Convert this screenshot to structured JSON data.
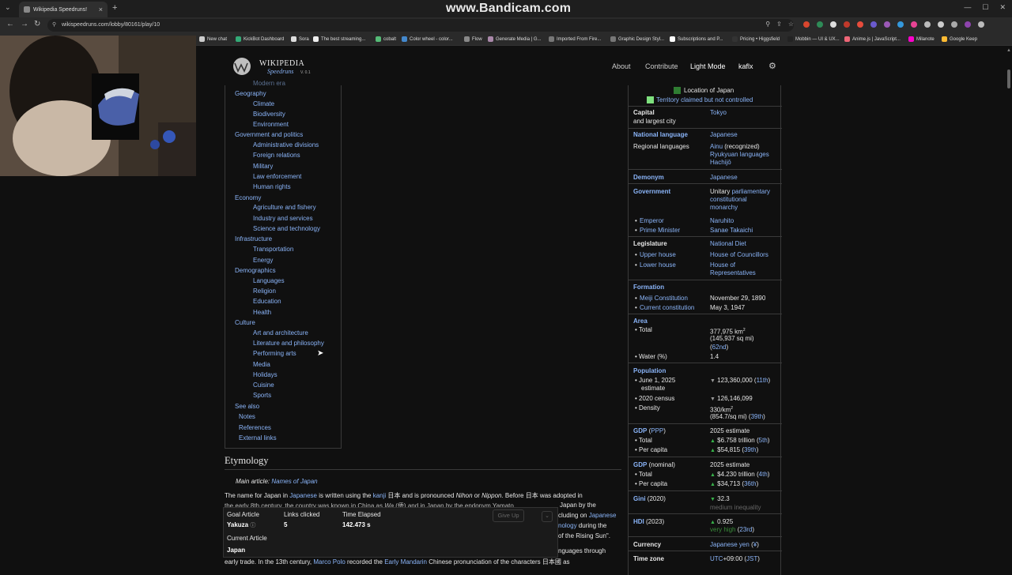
{
  "browser": {
    "tab_title": "Wikipedia Speedruns!",
    "url": "wikispeedruns.com/lobby/80161/play/10",
    "watermark": "www.Bandicam.com",
    "bookmarks": [
      "New chat",
      "KickBot Dashboard",
      "Sora",
      "The best streaming...",
      "cobalt",
      "Color wheel - color...",
      "Flow",
      "Generate Media | G...",
      "Imported From Fire...",
      "Graphic Design Styl...",
      "Subscriptions and P...",
      "Pricing • Higgsfield",
      "Mobbin — UI & UX...",
      "Anime.js | JavaScript...",
      "Milanote",
      "Google Keep"
    ]
  },
  "header": {
    "logo_title": "WIKIPEDIA",
    "logo_sub": "Speedruns",
    "version": "V. 0.1",
    "nav": {
      "about": "About",
      "contribute": "Contribute",
      "light_mode": "Light Mode",
      "user": "kaflx"
    }
  },
  "toc": {
    "items": [
      {
        "label": "Modern era",
        "indent": true
      },
      {
        "label": "Geography",
        "indent": false
      },
      {
        "label": "Climate",
        "indent": true
      },
      {
        "label": "Biodiversity",
        "indent": true
      },
      {
        "label": "Environment",
        "indent": true
      },
      {
        "label": "Government and politics",
        "indent": false
      },
      {
        "label": "Administrative divisions",
        "indent": true
      },
      {
        "label": "Foreign relations",
        "indent": true
      },
      {
        "label": "Military",
        "indent": true
      },
      {
        "label": "Law enforcement",
        "indent": true
      },
      {
        "label": "Human rights",
        "indent": true
      },
      {
        "label": "Economy",
        "indent": false
      },
      {
        "label": "Agriculture and fishery",
        "indent": true
      },
      {
        "label": "Industry and services",
        "indent": true
      },
      {
        "label": "Science and technology",
        "indent": true
      },
      {
        "label": "Infrastructure",
        "indent": false
      },
      {
        "label": "Transportation",
        "indent": true
      },
      {
        "label": "Energy",
        "indent": true
      },
      {
        "label": "Demographics",
        "indent": false
      },
      {
        "label": "Languages",
        "indent": true
      },
      {
        "label": "Religion",
        "indent": true
      },
      {
        "label": "Education",
        "indent": true
      },
      {
        "label": "Health",
        "indent": true
      },
      {
        "label": "Culture",
        "indent": false
      },
      {
        "label": "Art and architecture",
        "indent": true
      },
      {
        "label": "Literature and philosophy",
        "indent": true
      },
      {
        "label": "Performing arts",
        "indent": true
      },
      {
        "label": "Media",
        "indent": true
      },
      {
        "label": "Holidays",
        "indent": true
      },
      {
        "label": "Cuisine",
        "indent": true
      },
      {
        "label": "Sports",
        "indent": true
      },
      {
        "label": "See also",
        "indent": false
      },
      {
        "label": "Notes",
        "indent": "half"
      },
      {
        "label": "References",
        "indent": "half"
      },
      {
        "label": "External links",
        "indent": "half"
      }
    ]
  },
  "infobox": {
    "legend": {
      "location": "Location of Japan",
      "territory": "Territory claimed but not controlled"
    },
    "capital": {
      "label1": "Capital",
      "label2": "and largest city",
      "value": "Tokyo"
    },
    "national_language": {
      "label": "National language",
      "value": "Japanese"
    },
    "regional_languages": {
      "label": "Regional languages",
      "v1a": "Ainu",
      "v1b": " (recognized)",
      "v2": "Ryukyuan languages",
      "v3": "Hachijō"
    },
    "demonym": {
      "label": "Demonym",
      "value": "Japanese"
    },
    "government": {
      "label": "Government",
      "v_prefix": "Unitary ",
      "v1": "parliamentary",
      "v2": "constitutional",
      "v3": "monarchy"
    },
    "emperor": {
      "label": "Emperor",
      "value": "Naruhito"
    },
    "prime_minister": {
      "label": "Prime Minister",
      "value": "Sanae Takaichi"
    },
    "legislature": {
      "label": "Legislature",
      "value": "National Diet"
    },
    "upper_house": {
      "label": "Upper house",
      "value": "House of Councillors"
    },
    "lower_house": {
      "label": "Lower house",
      "v1": "House of",
      "v2": "Representatives"
    },
    "formation": {
      "label": "Formation"
    },
    "meiji": {
      "label": "Meiji Constitution",
      "value": "November 29, 1890"
    },
    "current_const": {
      "label": "Current constitution",
      "value": "May 3, 1947"
    },
    "area": {
      "label": "Area"
    },
    "area_total": {
      "label": "Total",
      "v1": "377,975 km",
      "v2": "(145,937 sq mi)",
      "v3": "62nd"
    },
    "water": {
      "label": "Water (%)",
      "value": "1.4"
    },
    "population": {
      "label": "Population"
    },
    "pop_2025": {
      "label1": "June 1, 2025",
      "label2": "estimate",
      "value": "123,360,000",
      "rank": "11th"
    },
    "pop_2020": {
      "label": "2020 census",
      "value": "126,146,099"
    },
    "density": {
      "label": "Density",
      "v1": "330/km",
      "v2": "(854.7/sq mi)",
      "rank": "39th"
    },
    "gdp_ppp": {
      "label": "GDP",
      "paren": "PPP",
      "year": "2025 estimate",
      "total_label": "Total",
      "total": "$6.758 trillion",
      "total_rank": "5th",
      "pc_label": "Per capita",
      "pc": "$54,815",
      "pc_rank": "39th"
    },
    "gdp_nom": {
      "label": "GDP",
      "paren": "(nominal)",
      "year": "2025 estimate",
      "total_label": "Total",
      "total": "$4.230 trillion",
      "total_rank": "4th",
      "pc_label": "Per capita",
      "pc": "$34,713",
      "pc_rank": "36th"
    },
    "gini": {
      "label": "Gini",
      "year": "(2020)",
      "value": "32.3",
      "note": "medium inequality"
    },
    "hdi": {
      "label": "HDI",
      "year": "(2023)",
      "value": "0.925",
      "note": "very high",
      "rank": "23rd"
    },
    "currency": {
      "label": "Currency",
      "value": "Japanese yen",
      "symbol": "¥"
    },
    "timezone": {
      "label": "Time zone",
      "v1": "UTC",
      "v2": "+09:00 (",
      "v3": "JST",
      "v4": ")"
    }
  },
  "article": {
    "heading": "Etymology",
    "main_article_label": "Main article: ",
    "main_article_link": "Names of Japan",
    "p1": {
      "a": "The name for Japan in ",
      "b": "Japanese",
      "c": " is written using the ",
      "d": "kanji",
      "e": " 日本 and is pronounced ",
      "f": "Nihon",
      "g": " or ",
      "h": "Nippon",
      "i": ". Before 日本 was adopted in"
    },
    "p2": {
      "a": "the early 8th century, the country was known in China as ",
      "b": "Wa",
      "c": " (倭) and in Japan by the endonym Yamato.",
      "d": "Japan by the"
    },
    "p3": {
      "a": "cluding on ",
      "b": "Japanese"
    },
    "p4": {
      "a": "nology",
      "b": " during the"
    },
    "p5": {
      "a": "of the Rising Sun\"."
    },
    "p6": {
      "a": "nguages through"
    },
    "p7": {
      "a": "early trade. In the 13th century, ",
      "b": "Marco Polo",
      "c": " recorded the ",
      "d": "Early Mandarin",
      "e": " Chinese pronunciation of the characters 日本國 as"
    }
  },
  "game": {
    "goal_label": "Goal Article",
    "goal_value": "Yakuza",
    "links_label": "Links clicked",
    "links_value": "5",
    "time_label": "Time Elapsed",
    "time_value": "142.473 s",
    "current_label": "Current Article",
    "current_value": "Japan",
    "give_up": "Give Up"
  }
}
